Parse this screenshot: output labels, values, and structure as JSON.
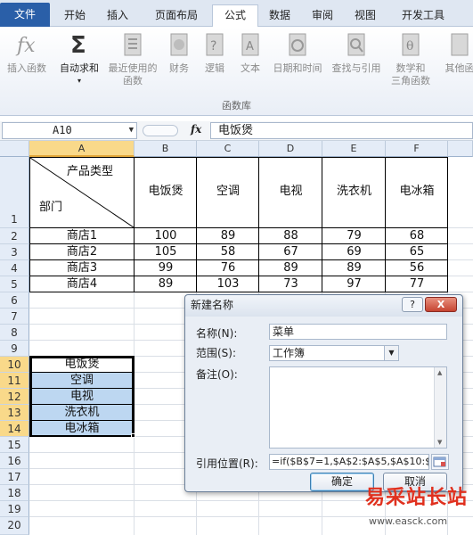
{
  "ribbon": {
    "tabs": [
      "文件",
      "开始",
      "插入",
      "页面布局",
      "公式",
      "数据",
      "审阅",
      "视图",
      "开发工具"
    ],
    "active_tab": "公式",
    "buttons": [
      {
        "label": "插入函数",
        "label2": "",
        "icon": "fx-icon"
      },
      {
        "label": "自动求和",
        "label2": "",
        "icon": "sigma-icon"
      },
      {
        "label": "最近使用的",
        "label2": "函数",
        "icon": "recent-functions-icon"
      },
      {
        "label": "财务",
        "label2": "",
        "icon": "finance-icon"
      },
      {
        "label": "逻辑",
        "label2": "",
        "icon": "logic-icon"
      },
      {
        "label": "文本",
        "label2": "",
        "icon": "text-icon"
      },
      {
        "label": "日期和时间",
        "label2": "",
        "icon": "datetime-icon"
      },
      {
        "label": "查找与引用",
        "label2": "",
        "icon": "lookup-icon"
      },
      {
        "label": "数学和",
        "label2": "三角函数",
        "icon": "math-icon"
      },
      {
        "label": "其他函",
        "label2": "",
        "icon": "more-functions-icon"
      }
    ],
    "group_label": "函数库"
  },
  "formula_bar": {
    "name_box": "A10",
    "fx": "fx",
    "value": "电饭煲"
  },
  "sheet": {
    "columns": [
      "A",
      "B",
      "C",
      "D",
      "E",
      "F"
    ],
    "rows": [
      "1",
      "2",
      "3",
      "4",
      "5",
      "6",
      "7",
      "8",
      "9",
      "10",
      "11",
      "12",
      "13",
      "14",
      "15",
      "16",
      "17",
      "18",
      "19",
      "20"
    ],
    "header_cell": {
      "top": "产品类型",
      "bottom": "部门"
    },
    "products": [
      "电饭煲",
      "空调",
      "电视",
      "洗衣机",
      "电冰箱"
    ],
    "stores": [
      "商店1",
      "商店2",
      "商店3",
      "商店4"
    ],
    "values": [
      [
        "100",
        "89",
        "88",
        "79",
        "68"
      ],
      [
        "105",
        "58",
        "67",
        "69",
        "65"
      ],
      [
        "99",
        "76",
        "89",
        "89",
        "56"
      ],
      [
        "89",
        "103",
        "73",
        "97",
        "77"
      ]
    ],
    "list_items": [
      "电饭煲",
      "空调",
      "电视",
      "洗衣机",
      "电冰箱"
    ]
  },
  "dialog": {
    "title": "新建名称",
    "help": "?",
    "close": "X",
    "name_label": "名称(N):",
    "name_value": "菜单",
    "scope_label": "范围(S):",
    "scope_value": "工作簿",
    "comment_label": "备注(O):",
    "ref_label": "引用位置(R):",
    "ref_value": "=if($B$7=1,$A$2:$A$5,$A$10:$A$",
    "ok": "确定",
    "cancel": "取消"
  },
  "watermark": {
    "text": "易采站长站",
    "url": "www.easck.com"
  },
  "colors": {
    "file_tab": "#2a5fa8",
    "selection": "#bdd7f1",
    "header_selected": "#f9d98a",
    "watermark": "#e0311f"
  }
}
